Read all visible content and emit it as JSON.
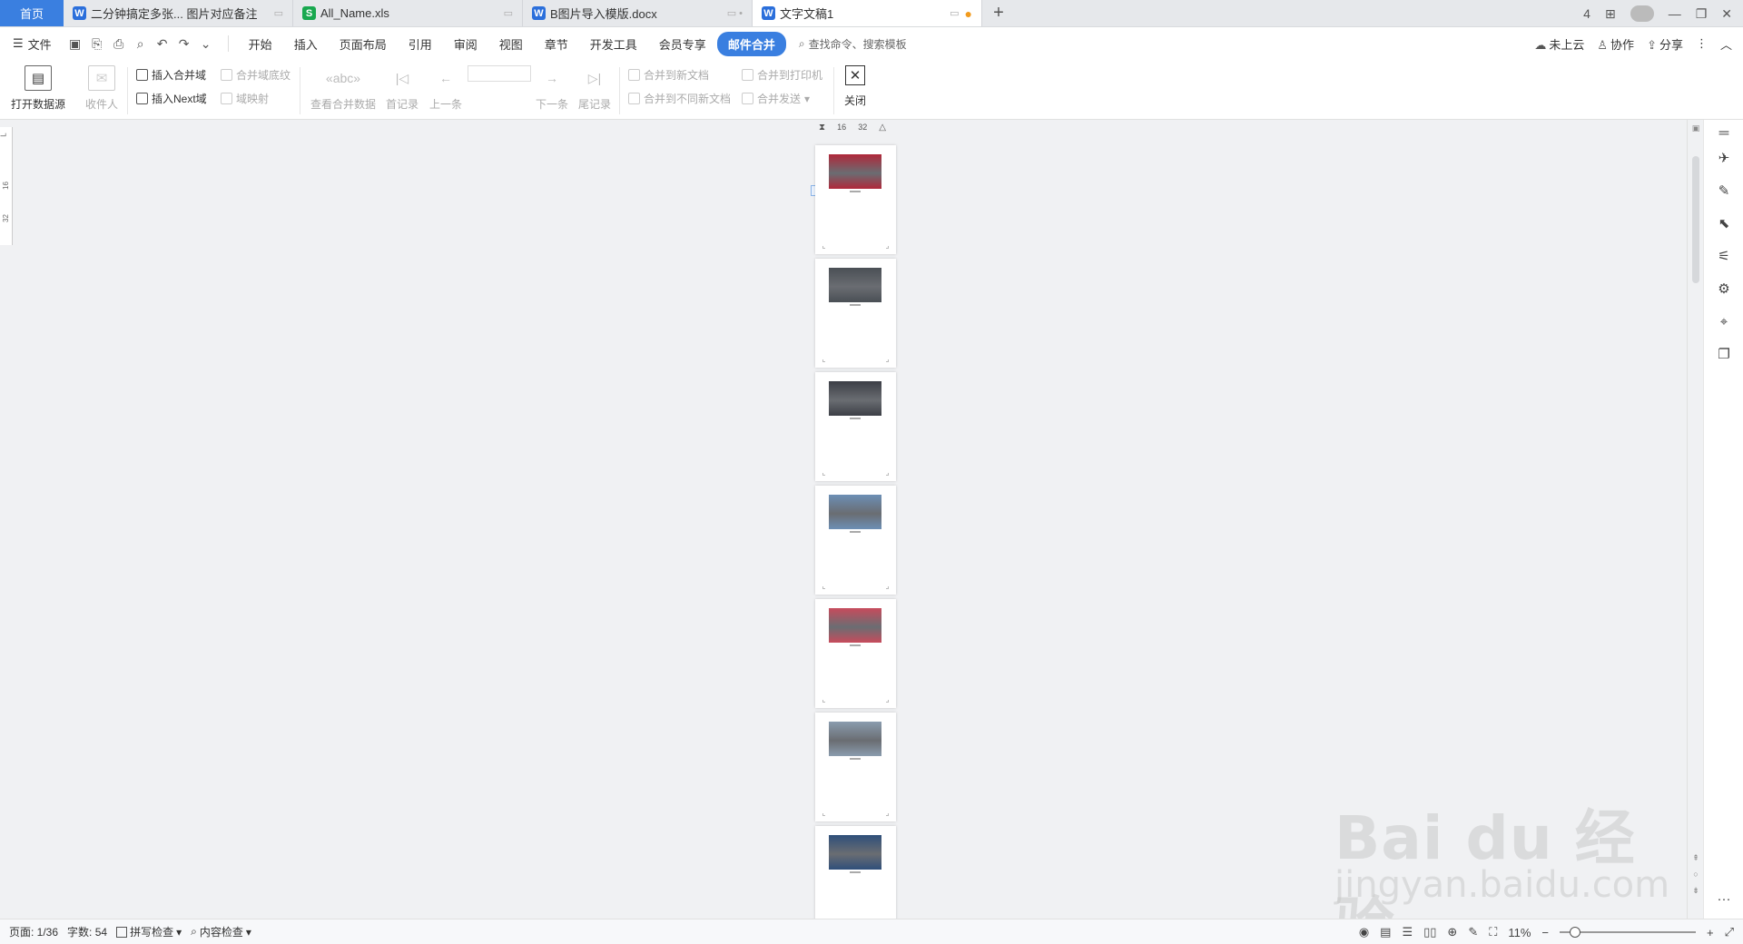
{
  "tabs": {
    "home": "首页",
    "items": [
      {
        "label": "二分钟搞定多张... 图片对应备注",
        "type": "w",
        "active": false,
        "dot": false
      },
      {
        "label": "All_Name.xls",
        "type": "s",
        "active": false,
        "dot": false
      },
      {
        "label": "B图片导入模版.docx",
        "type": "w",
        "active": false,
        "dot": false
      },
      {
        "label": "文字文稿1",
        "type": "w",
        "active": true,
        "dot": true
      }
    ],
    "add": "+",
    "right_badge": "4"
  },
  "menubar": {
    "file": "文件",
    "items": [
      "开始",
      "插入",
      "页面布局",
      "引用",
      "审阅",
      "视图",
      "章节",
      "开发工具",
      "会员专享"
    ],
    "active_item": "邮件合并",
    "search": "查找命令、搜索模板",
    "cloud": "未上云",
    "collab": "协作",
    "share": "分享"
  },
  "ribbon": {
    "open_source": "打开数据源",
    "recipients": "收件人",
    "insert_merge_field": "插入合并域",
    "insert_next_field": "插入Next域",
    "merge_field_shading": "合并域底纹",
    "field_mapping": "域映射",
    "view_merge_data": "查看合并数据",
    "first_record": "首记录",
    "prev": "上一条",
    "next": "下一条",
    "last_record": "尾记录",
    "merge_new_doc": "合并到新文档",
    "merge_diff_doc": "合并到不同新文档",
    "merge_printer": "合并到打印机",
    "merge_send": "合并发送",
    "close": "关闭"
  },
  "ruler": {
    "h1": "16",
    "h2": "32",
    "v0": "L",
    "v1": "16",
    "v2": "32"
  },
  "pages": [
    {
      "color": "#b0283a"
    },
    {
      "color": "#4a4f55"
    },
    {
      "color": "#3c3f46"
    },
    {
      "color": "#6c8fb5"
    },
    {
      "color": "#c84b5c"
    },
    {
      "color": "#8a9cae"
    },
    {
      "color": "#2f4f7a"
    }
  ],
  "status": {
    "page": "页面: 1/36",
    "words": "字数: 54",
    "spell": "拼写检查",
    "content_check": "内容检查",
    "zoom": "11%",
    "zoom_value": 0.11
  },
  "watermark": {
    "line1": "Bai du 经验",
    "line2": "jingyan.baidu.com"
  }
}
